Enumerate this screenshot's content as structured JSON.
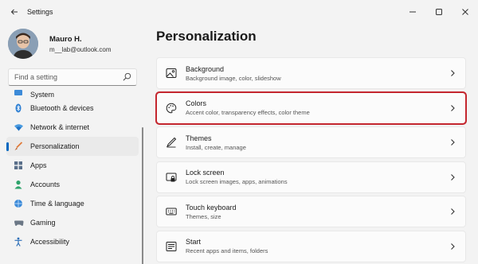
{
  "window": {
    "title": "Settings",
    "controls": [
      "minimize",
      "maximize",
      "close"
    ]
  },
  "profile": {
    "name": "Mauro H.",
    "email": "m__lab@outlook.com"
  },
  "search": {
    "placeholder": "Find a setting",
    "value": ""
  },
  "sidebar": {
    "items": [
      {
        "label": "System",
        "icon": "monitor-icon"
      },
      {
        "label": "Bluetooth & devices",
        "icon": "bluetooth-icon"
      },
      {
        "label": "Network & internet",
        "icon": "wifi-icon"
      },
      {
        "label": "Personalization",
        "icon": "brush-icon",
        "selected": true
      },
      {
        "label": "Apps",
        "icon": "apps-icon"
      },
      {
        "label": "Accounts",
        "icon": "person-icon"
      },
      {
        "label": "Time & language",
        "icon": "globe-clock-icon"
      },
      {
        "label": "Gaming",
        "icon": "gamepad-icon"
      },
      {
        "label": "Accessibility",
        "icon": "accessibility-icon"
      }
    ]
  },
  "main": {
    "title": "Personalization",
    "cards": [
      {
        "title": "Background",
        "subtitle": "Background image, color, slideshow",
        "icon": "image-icon"
      },
      {
        "title": "Colors",
        "subtitle": "Accent color, transparency effects, color theme",
        "icon": "palette-icon",
        "highlighted": true
      },
      {
        "title": "Themes",
        "subtitle": "Install, create, manage",
        "icon": "pen-icon"
      },
      {
        "title": "Lock screen",
        "subtitle": "Lock screen images, apps, animations",
        "icon": "lock-screen-icon"
      },
      {
        "title": "Touch keyboard",
        "subtitle": "Themes, size",
        "icon": "keyboard-icon"
      },
      {
        "title": "Start",
        "subtitle": "Recent apps and items, folders",
        "icon": "start-icon"
      }
    ]
  },
  "colors": {
    "accent": "#0067c0",
    "highlight_border": "#c4262e",
    "background": "#f3f3f3",
    "card": "#fbfbfb"
  }
}
